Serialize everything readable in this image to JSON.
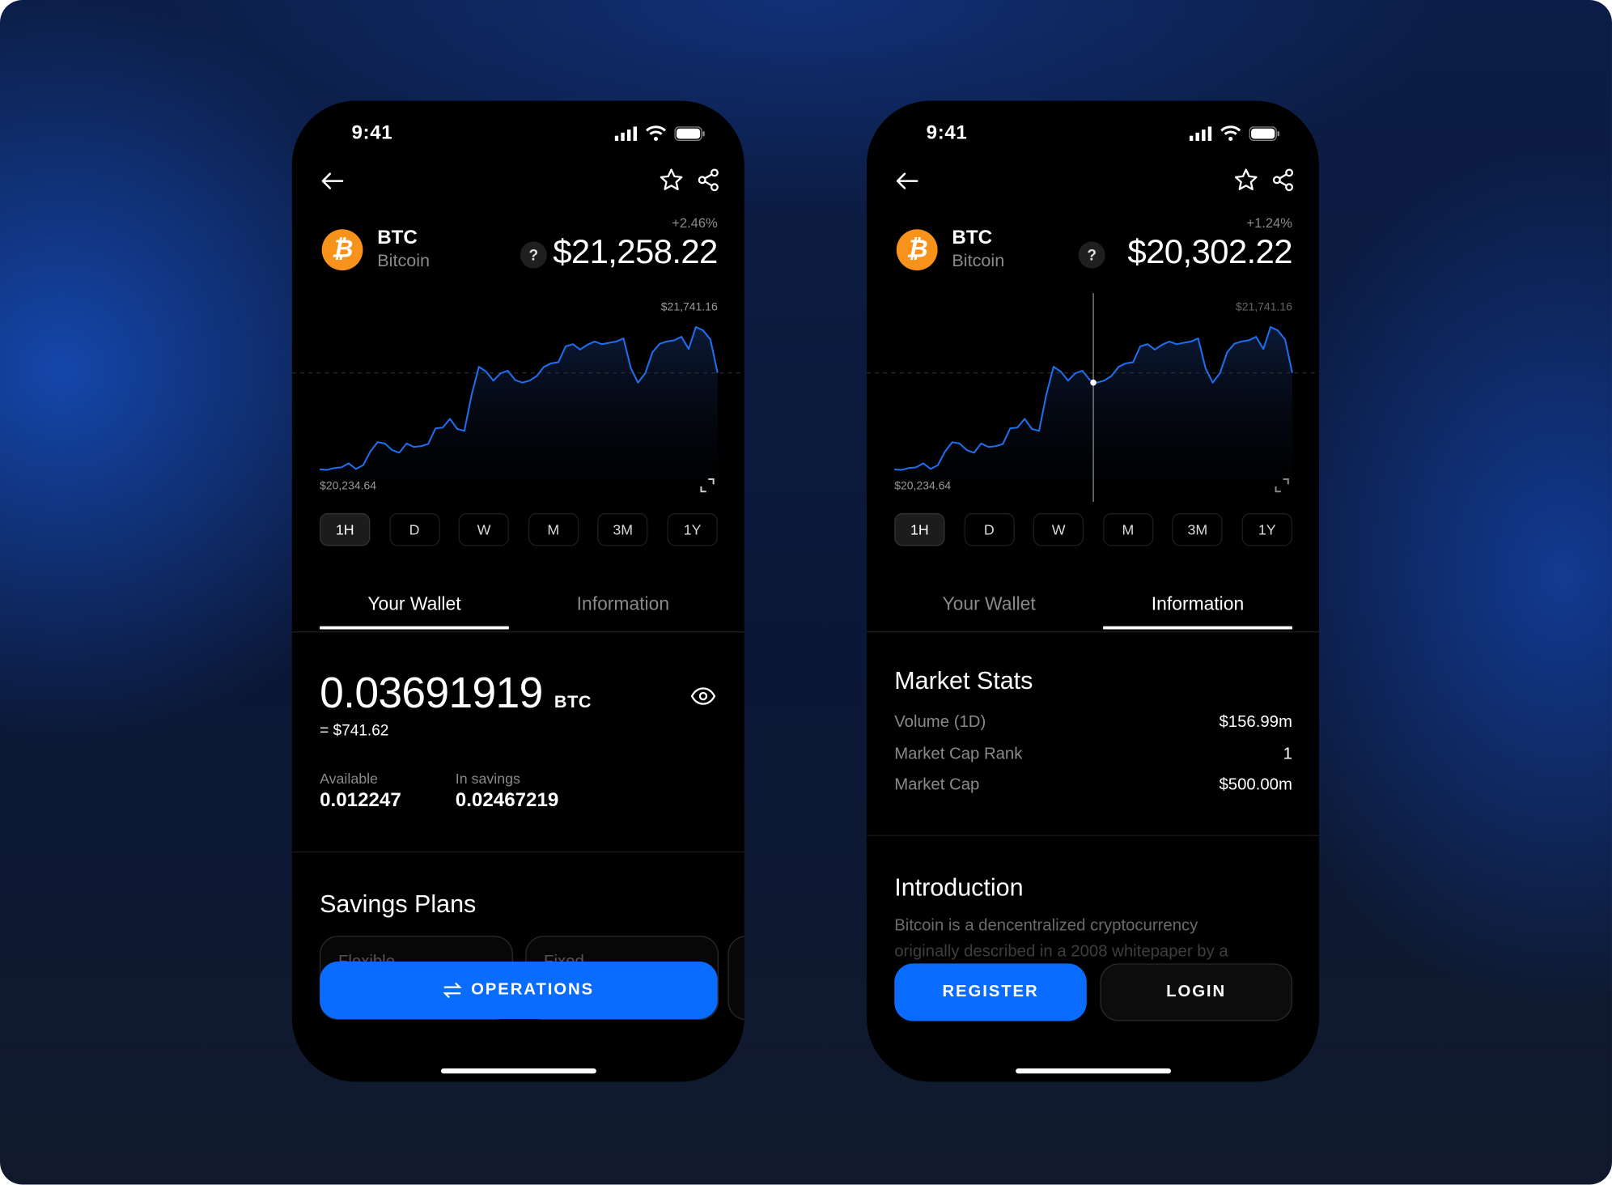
{
  "colors": {
    "accent": "#0A6CFF",
    "line": "#1E6FF0",
    "bitcoin": "#F7931A",
    "background": "#000000"
  },
  "phones": [
    {
      "status": {
        "time": "9:41"
      },
      "asset": {
        "symbol": "BTC",
        "name": "Bitcoin",
        "icon": "bitcoin-icon",
        "icon_glyph": "₿",
        "change": "+2.46%",
        "price": "$21,258.22",
        "help": "?"
      },
      "chart": {
        "max_label": "$21,741.16",
        "min_label": "$20,234.64",
        "crosshair": false
      },
      "periods": [
        {
          "label": "1H",
          "selected": true
        },
        {
          "label": "D"
        },
        {
          "label": "W"
        },
        {
          "label": "M"
        },
        {
          "label": "3M"
        },
        {
          "label": "1Y"
        }
      ],
      "tabs": [
        {
          "label": "Your Wallet",
          "active": true
        },
        {
          "label": "Information"
        }
      ],
      "wallet": {
        "balance": "0.03691919",
        "unit": "BTC",
        "fiat": "= $741.62",
        "available_label": "Available",
        "available": "0.012247",
        "savings_label": "In savings",
        "savings": "0.02467219"
      },
      "savings_plans": {
        "title": "Savings Plans",
        "cards": [
          "Flexible",
          "Fixed"
        ]
      },
      "operations_label": "OPERATIONS"
    },
    {
      "status": {
        "time": "9:41"
      },
      "asset": {
        "symbol": "BTC",
        "name": "Bitcoin",
        "icon": "bitcoin-icon",
        "icon_glyph": "₿",
        "change": "+1.24%",
        "price": "$20,302.22",
        "help": "?"
      },
      "chart": {
        "max_label": "$21,741.16",
        "min_label": "$20,234.64",
        "crosshair": true,
        "crosshair_index": 28
      },
      "periods": [
        {
          "label": "1H",
          "selected": true
        },
        {
          "label": "D"
        },
        {
          "label": "W"
        },
        {
          "label": "M"
        },
        {
          "label": "3M"
        },
        {
          "label": "1Y"
        }
      ],
      "tabs": [
        {
          "label": "Your Wallet"
        },
        {
          "label": "Information",
          "active": true
        }
      ],
      "market_stats": {
        "title": "Market Stats",
        "rows": [
          {
            "label": "Volume (1D)",
            "value": "$156.99m"
          },
          {
            "label": "Market Cap Rank",
            "value": "1"
          },
          {
            "label": "Market Cap",
            "value": "$500.00m"
          }
        ]
      },
      "introduction": {
        "title": "Introduction",
        "lines": [
          "Bitcoin is a dencentralized cryptocurrency",
          "originally described in a 2008 whitepaper by a"
        ]
      },
      "register_label": "REGISTER",
      "login_label": "LOGIN"
    }
  ],
  "chart_data": {
    "type": "area",
    "ylim": [
      20234.64,
      21741.16
    ],
    "reference_line": 21258.22,
    "grid": false,
    "values": [
      20240,
      20234.64,
      20254,
      20262,
      20304,
      20246,
      20285,
      20430,
      20527,
      20513,
      20444,
      20416,
      20513,
      20477,
      20485,
      20508,
      20672,
      20681,
      20773,
      20667,
      20647,
      21030,
      21322,
      21272,
      21175,
      21253,
      21281,
      21183,
      21155,
      21177,
      21225,
      21322,
      21359,
      21370,
      21537,
      21560,
      21504,
      21554,
      21588,
      21560,
      21574,
      21588,
      21621,
      21309,
      21155,
      21253,
      21476,
      21565,
      21588,
      21601,
      21638,
      21509,
      21741.16,
      21705,
      21610,
      21258
    ]
  }
}
